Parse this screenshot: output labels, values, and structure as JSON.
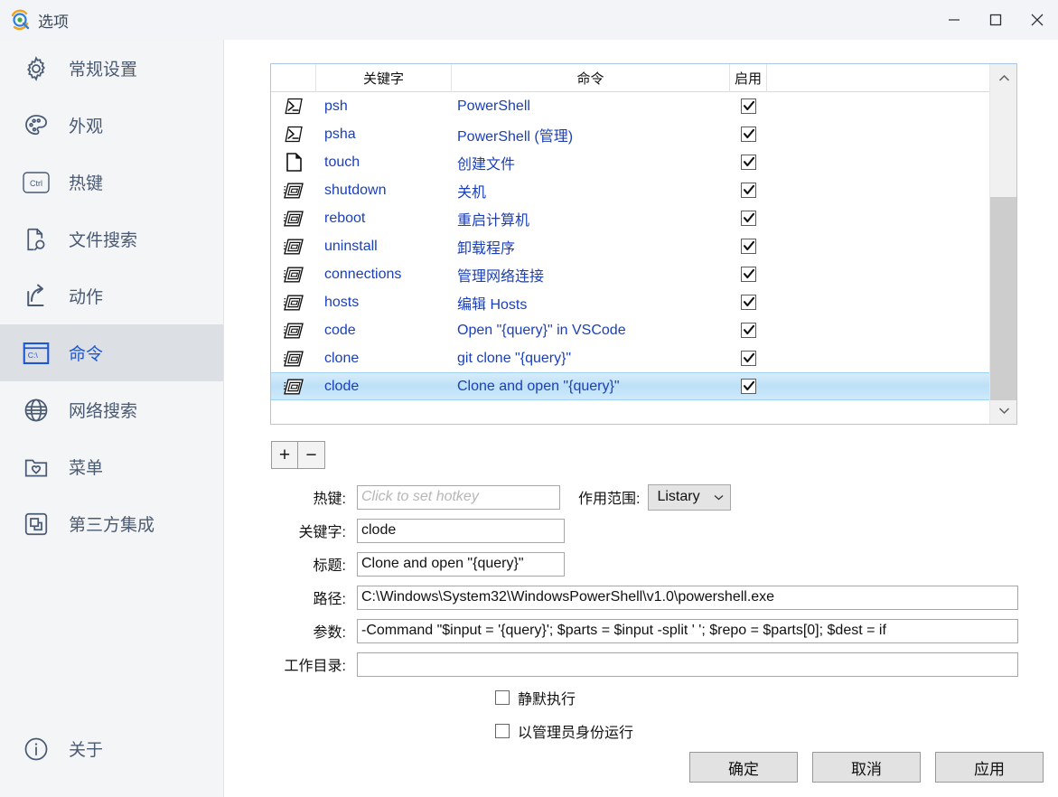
{
  "window": {
    "title": "选项",
    "logo_icon": "listary-logo-icon",
    "controls": [
      {
        "name": "minimize-button",
        "icon": "minimize-icon"
      },
      {
        "name": "maximize-button",
        "icon": "maximize-icon"
      },
      {
        "name": "close-button",
        "icon": "close-icon"
      }
    ]
  },
  "sidebar": {
    "items": [
      {
        "label": "常规设置",
        "icon": "gear-icon",
        "selected": false
      },
      {
        "label": "外观",
        "icon": "palette-icon",
        "selected": false
      },
      {
        "label": "热键",
        "icon": "ctrl-key-icon",
        "selected": false
      },
      {
        "label": "文件搜索",
        "icon": "file-search-icon",
        "selected": false
      },
      {
        "label": "动作",
        "icon": "share-arrow-icon",
        "selected": false
      },
      {
        "label": "命令",
        "icon": "command-prompt-icon",
        "selected": true
      },
      {
        "label": "网络搜索",
        "icon": "globe-icon",
        "selected": false
      },
      {
        "label": "菜单",
        "icon": "folder-heart-icon",
        "selected": false
      },
      {
        "label": "第三方集成",
        "icon": "plugin-icon",
        "selected": false
      }
    ],
    "about": {
      "label": "关于",
      "icon": "info-icon"
    }
  },
  "list": {
    "columns": [
      "",
      "关键字",
      "命令",
      "启用",
      ""
    ],
    "rows": [
      {
        "icon": "powershell-icon",
        "keyword": "psh",
        "command": "PowerShell",
        "enabled": true,
        "selected": false
      },
      {
        "icon": "powershell-icon",
        "keyword": "psha",
        "command": "PowerShell (管理)",
        "enabled": true,
        "selected": false
      },
      {
        "icon": "file-icon",
        "keyword": "touch",
        "command": "创建文件",
        "enabled": true,
        "selected": false
      },
      {
        "icon": "app-window-icon",
        "keyword": "shutdown",
        "command": "关机",
        "enabled": true,
        "selected": false
      },
      {
        "icon": "app-window-icon",
        "keyword": "reboot",
        "command": "重启计算机",
        "enabled": true,
        "selected": false
      },
      {
        "icon": "app-window-icon",
        "keyword": "uninstall",
        "command": "卸载程序",
        "enabled": true,
        "selected": false
      },
      {
        "icon": "app-window-icon",
        "keyword": "connections",
        "command": "管理网络连接",
        "enabled": true,
        "selected": false
      },
      {
        "icon": "app-window-icon",
        "keyword": "hosts",
        "command": "编辑 Hosts",
        "enabled": true,
        "selected": false
      },
      {
        "icon": "app-window-icon",
        "keyword": "code",
        "command": "Open \"{query}\" in VSCode",
        "enabled": true,
        "selected": false
      },
      {
        "icon": "app-window-icon",
        "keyword": "clone",
        "command": "git clone \"{query}\"",
        "enabled": true,
        "selected": false
      },
      {
        "icon": "app-window-icon",
        "keyword": "clode",
        "command": "Clone and open \"{query}\"",
        "enabled": true,
        "selected": true
      }
    ]
  },
  "toolbar": {
    "add_label": "+",
    "remove_label": "−"
  },
  "form": {
    "hotkey_label": "热键:",
    "hotkey_placeholder": "Click to set hotkey",
    "hotkey_value": "",
    "scope_label": "作用范围:",
    "scope_value": "Listary",
    "keyword_label": "关键字:",
    "keyword_value": "clode",
    "title_label": "标题:",
    "title_value": "Clone and open \"{query}\"",
    "path_label": "路径:",
    "path_value": "C:\\Windows\\System32\\WindowsPowerShell\\v1.0\\powershell.exe",
    "args_label": "参数:",
    "args_value": "-Command \"$input = '{query}'; $parts = $input -split ' '; $repo = $parts[0]; $dest = if",
    "workdir_label": "工作目录:",
    "workdir_value": "",
    "silent_label": "静默执行",
    "silent_checked": false,
    "admin_label": "以管理员身份运行",
    "admin_checked": false
  },
  "buttons": {
    "ok": "确定",
    "cancel": "取消",
    "apply": "应用"
  },
  "colors": {
    "accent": "#1a56d6",
    "link": "#1a3fb8",
    "selection": "#bde0f7",
    "sidebar_bg": "#f4f5f7",
    "titlebar_bg": "#f2f4f7"
  }
}
